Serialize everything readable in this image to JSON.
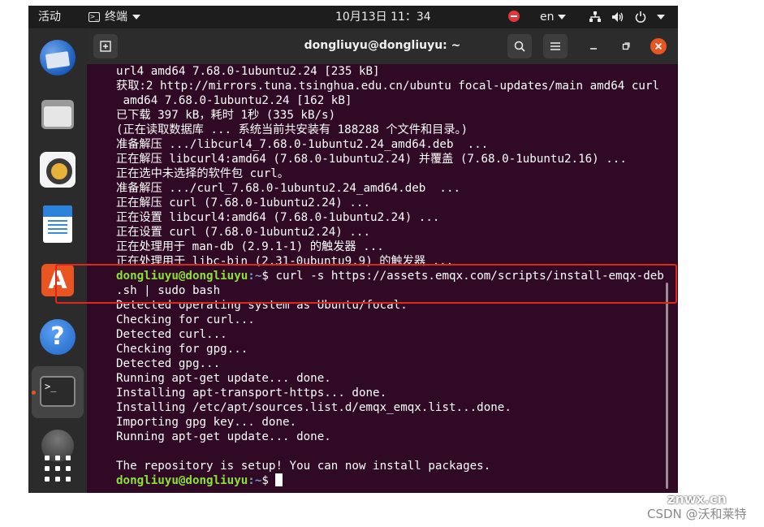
{
  "topbar": {
    "activities": "活动",
    "app_menu": "终端",
    "clock": "10月13日  11：34",
    "language": "en"
  },
  "terminal": {
    "title": "dongliuyu@dongliuyu: ~",
    "prompt_user": "dongliuyu@dongliuyu",
    "prompt_path": ":~",
    "prompt_symbol": "$ ",
    "lines_before": [
      "url4 amd64 7.68.0-1ubuntu2.24 [235 kB]",
      "获取:2 http://mirrors.tuna.tsinghua.edu.cn/ubuntu focal-updates/main amd64 curl",
      " amd64 7.68.0-1ubuntu2.24 [162 kB]",
      "已下载 397 kB，耗时 1秒 (335 kB/s)",
      "(正在读取数据库 ... 系统当前共安装有 188288 个文件和目录。)",
      "准备解压 .../libcurl4_7.68.0-1ubuntu2.24_amd64.deb  ...",
      "正在解压 libcurl4:amd64 (7.68.0-1ubuntu2.24) 并覆盖 (7.68.0-1ubuntu2.16) ...",
      "正在选中未选择的软件包 curl。",
      "准备解压 .../curl_7.68.0-1ubuntu2.24_amd64.deb  ...",
      "正在解压 curl (7.68.0-1ubuntu2.24) ...",
      "正在设置 libcurl4:amd64 (7.68.0-1ubuntu2.24) ...",
      "正在设置 curl (7.68.0-1ubuntu2.24) ...",
      "正在处理用于 man-db (2.9.1-1) 的触发器 ...",
      "正在处理用于 libc-bin (2.31-0ubuntu9.9) 的触发器 ..."
    ],
    "command": "curl -s https://assets.emqx.com/scripts/install-emqx-deb",
    "command_cont": ".sh | sudo bash",
    "lines_after": [
      "Detected operating system as Ubuntu/focal.",
      "Checking for curl...",
      "Detected curl...",
      "Checking for gpg...",
      "Detected gpg...",
      "Running apt-get update... done.",
      "Installing apt-transport-https... done.",
      "Installing /etc/apt/sources.list.d/emqx_emqx.list...done.",
      "Importing gpg key... done.",
      "Running apt-get update... done.",
      "",
      "The repository is setup! You can now install packages."
    ]
  },
  "watermark": {
    "text": "CSDN @沃和莱特",
    "site": "znwx.cn"
  },
  "colors": {
    "terminal_bg": "#300a24",
    "prompt_user": "#8ae234",
    "prompt_path": "#729fcf",
    "highlight_border": "#e0261c",
    "accent": "#e95420"
  },
  "icons": {
    "dock": [
      "thunderbird-icon",
      "files-icon",
      "rhythmbox-icon",
      "writer-icon",
      "software-icon",
      "help-icon",
      "terminal-icon",
      "disc-icon",
      "app-grid-icon"
    ]
  }
}
